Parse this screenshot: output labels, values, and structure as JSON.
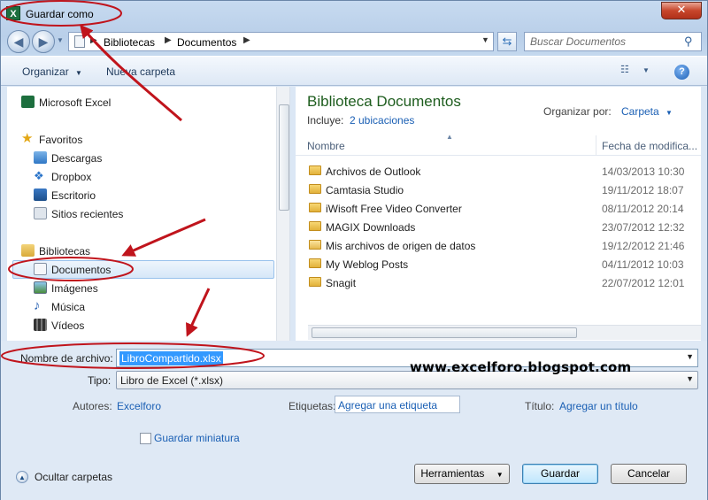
{
  "window": {
    "title": "Guardar como",
    "close_glyph": "✕",
    "app_icon": "excel-icon"
  },
  "navigation": {
    "breadcrumb": [
      "Bibliotecas",
      "Documentos"
    ],
    "search_placeholder": "Buscar Documentos"
  },
  "toolbar": {
    "organize_label": "Organizar",
    "new_folder_label": "Nueva carpeta",
    "help_glyph": "?"
  },
  "sidebar": {
    "items": [
      {
        "label": "Microsoft Excel",
        "icon": "excel-icon"
      },
      {
        "label": "Favoritos",
        "icon": "star-icon"
      },
      {
        "label": "Descargas",
        "icon": "downloads-icon"
      },
      {
        "label": "Dropbox",
        "icon": "dropbox-icon"
      },
      {
        "label": "Escritorio",
        "icon": "desktop-icon"
      },
      {
        "label": "Sitios recientes",
        "icon": "recent-places-icon"
      },
      {
        "label": "Bibliotecas",
        "icon": "libraries-icon"
      },
      {
        "label": "Documentos",
        "icon": "documents-icon",
        "selected": true
      },
      {
        "label": "Imágenes",
        "icon": "pictures-icon"
      },
      {
        "label": "Música",
        "icon": "music-icon"
      },
      {
        "label": "Vídeos",
        "icon": "videos-icon"
      }
    ]
  },
  "library": {
    "title": "Biblioteca Documentos",
    "includes_label": "Incluye:",
    "includes_link": "2 ubicaciones",
    "arrange_label": "Organizar por:",
    "arrange_value": "Carpeta",
    "columns": {
      "name": "Nombre",
      "date": "Fecha de modifica..."
    },
    "files": [
      {
        "name": "Archivos de Outlook",
        "date": "14/03/2013 10:30",
        "icon": "folder-icon"
      },
      {
        "name": "Camtasia Studio",
        "date": "19/11/2012 18:07",
        "icon": "folder-icon"
      },
      {
        "name": "iWisoft Free Video Converter",
        "date": "08/11/2012 20:14",
        "icon": "folder-icon"
      },
      {
        "name": "MAGIX Downloads",
        "date": "23/07/2012 12:32",
        "icon": "folder-icon"
      },
      {
        "name": "Mis archivos de origen de datos",
        "date": "19/12/2012 21:46",
        "icon": "data-sources-folder-icon"
      },
      {
        "name": "My Weblog Posts",
        "date": "04/11/2012 10:03",
        "icon": "folder-icon"
      },
      {
        "name": "Snagit",
        "date": "22/07/2012 12:01",
        "icon": "folder-icon"
      }
    ]
  },
  "form": {
    "filename_label": "Nombre de archivo:",
    "filename_value": "LibroCompartido.xlsx",
    "type_label": "Tipo:",
    "type_value": "Libro de Excel (*.xlsx)",
    "authors_label": "Autores:",
    "authors_value": "Excelforo",
    "tags_label": "Etiquetas:",
    "tags_value": "Agregar una etiqueta",
    "title_label": "Título:",
    "title_value": "Agregar un título",
    "thumbnail_label": "Guardar miniatura"
  },
  "footer": {
    "hide_folders": "Ocultar carpetas",
    "tools": "Herramientas",
    "save": "Guardar",
    "cancel": "Cancelar"
  },
  "watermark": "www.excelforo.blogspot.com",
  "annotation_color": "#c0141c"
}
